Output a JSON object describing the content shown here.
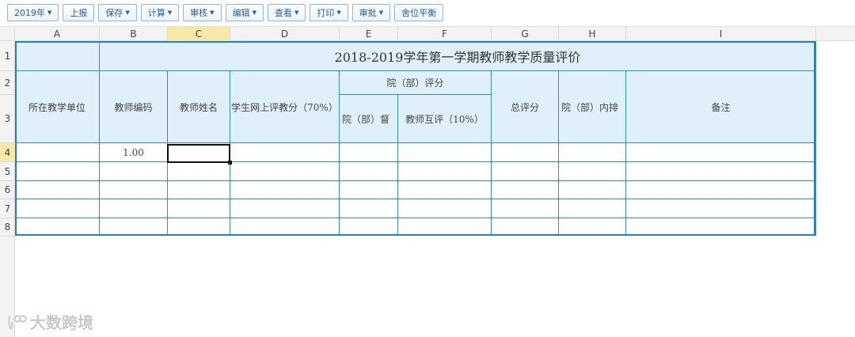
{
  "toolbar": {
    "buttons": [
      {
        "label": "2019年",
        "dropdown": true
      },
      {
        "label": "上报",
        "dropdown": false
      },
      {
        "label": "保存",
        "dropdown": true
      },
      {
        "label": "计算",
        "dropdown": true
      },
      {
        "label": "审核",
        "dropdown": true
      },
      {
        "label": "编辑",
        "dropdown": true
      },
      {
        "label": "查看",
        "dropdown": true
      },
      {
        "label": "打印",
        "dropdown": true
      },
      {
        "label": "审批",
        "dropdown": true
      },
      {
        "label": "舍位平衡",
        "dropdown": false
      }
    ]
  },
  "columns": [
    "A",
    "B",
    "C",
    "D",
    "E",
    "F",
    "G",
    "H",
    "I"
  ],
  "rows": [
    "1",
    "2",
    "3",
    "4",
    "5",
    "6",
    "7",
    "8"
  ],
  "selected": {
    "column": "C",
    "row": "4"
  },
  "table": {
    "title": "2018-2019学年第一学期教师教学质量评价",
    "unit_header": "所在教学单位",
    "teacher_code_header": "教师编码",
    "teacher_name_header": "教师姓名",
    "student_eval_header": "学生网上评教分（70%）",
    "dept_score_header": "院（部）评分",
    "dept_supervise_header": "院（部）督",
    "peer_eval_header": "教师互评（10%）",
    "total_header": "总评分",
    "dept_rank_header": "院（部）内排",
    "remarks_header": "备注",
    "row4_teacher_code": "1.00"
  },
  "watermark": {
    "text": "大数跨境"
  }
}
